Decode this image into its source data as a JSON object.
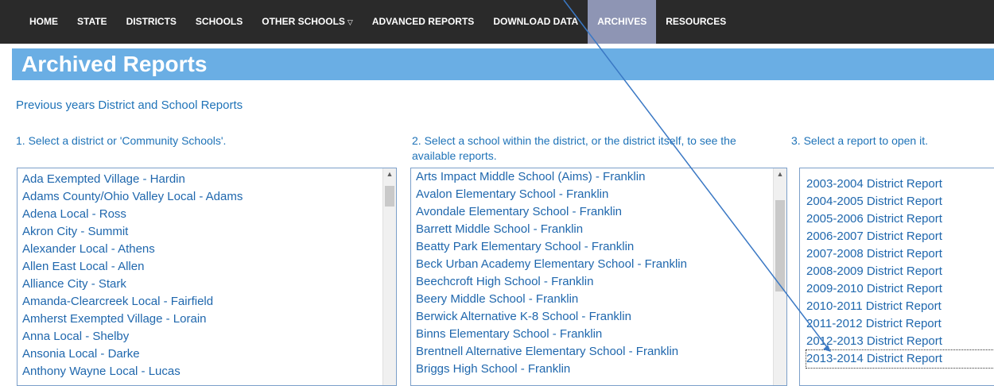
{
  "nav": {
    "items": [
      {
        "label": "HOME",
        "active": false
      },
      {
        "label": "STATE",
        "active": false
      },
      {
        "label": "DISTRICTS",
        "active": false
      },
      {
        "label": "SCHOOLS",
        "active": false
      },
      {
        "label": "OTHER SCHOOLS",
        "active": false,
        "dropdown": true
      },
      {
        "label": "ADVANCED REPORTS",
        "active": false
      },
      {
        "label": "DOWNLOAD DATA",
        "active": false
      },
      {
        "label": "ARCHIVES",
        "active": true
      },
      {
        "label": "RESOURCES",
        "active": false
      }
    ],
    "caret_icon": "chevron-down-icon"
  },
  "page": {
    "title": "Archived Reports",
    "subtitle": "Previous years District and School Reports"
  },
  "steps": {
    "step1": "1. Select a district or 'Community Schools'.",
    "step2": "2. Select a school within the district, or the district itself, to see the available reports.",
    "step3": "3. Select a report to open it."
  },
  "districts": [
    "Ada Exempted Village - Hardin",
    "Adams County/Ohio Valley Local - Adams",
    "Adena Local - Ross",
    "Akron City - Summit",
    "Alexander Local - Athens",
    "Allen East Local - Allen",
    "Alliance City - Stark",
    "Amanda-Clearcreek Local - Fairfield",
    "Amherst Exempted Village - Lorain",
    "Anna Local - Shelby",
    "Ansonia Local - Darke",
    "Anthony Wayne Local - Lucas"
  ],
  "schools": [
    "Arts Impact Middle School (Aims) - Franklin",
    "Avalon Elementary School - Franklin",
    "Avondale Elementary School - Franklin",
    "Barrett Middle School - Franklin",
    "Beatty Park Elementary School - Franklin",
    "Beck Urban Academy Elementary School - Franklin",
    "Beechcroft High School - Franklin",
    "Beery Middle School - Franklin",
    "Berwick Alternative K-8 School - Franklin",
    "Binns Elementary School - Franklin",
    "Brentnell Alternative Elementary School - Franklin",
    "Briggs High School - Franklin"
  ],
  "reports": [
    "2003-2004 District Report",
    "2004-2005 District Report",
    "2005-2006 District Report",
    "2006-2007 District Report",
    "2007-2008 District Report",
    "2008-2009 District Report",
    "2009-2010 District Report",
    "2010-2011 District Report",
    "2011-2012 District Report",
    "2012-2013 District Report",
    "2013-2014 District Report"
  ],
  "selected_report_index": 10,
  "colors": {
    "nav_bg": "#2a2a2a",
    "nav_active": "#8e95b4",
    "banner": "#6aaee4",
    "link": "#1f67ad",
    "annotation_line": "#3a78c4"
  }
}
